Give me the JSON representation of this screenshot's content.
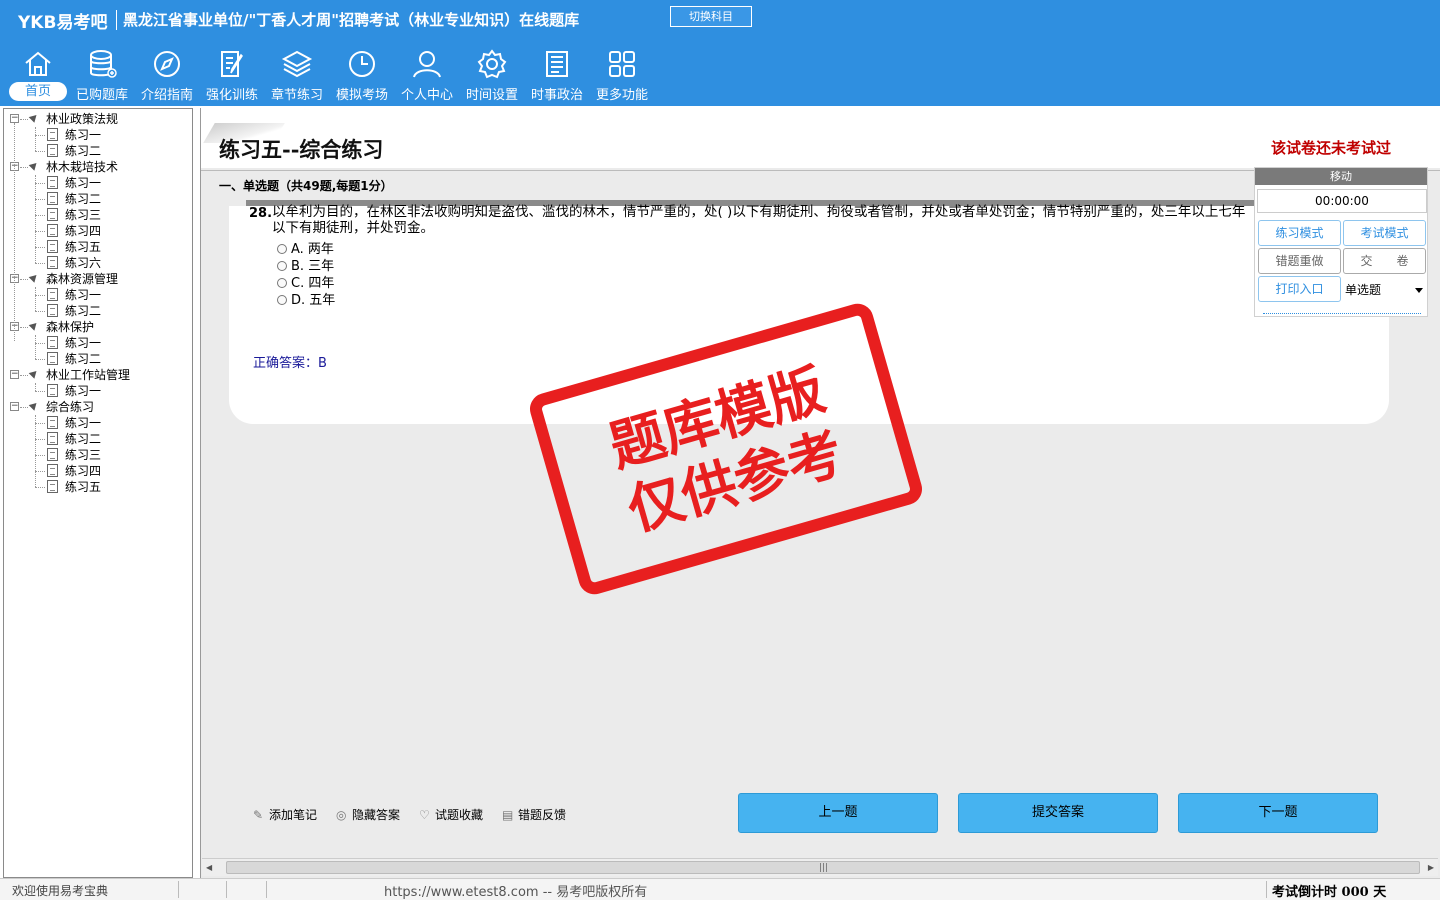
{
  "header": {
    "logo": "YKB易考吧",
    "title": "黑龙江省事业单位/\"丁香人才周\"招聘考试（林业专业知识）在线题库",
    "switch_label": "切换科目",
    "nav": [
      {
        "label": "首页",
        "icon": "home-icon"
      },
      {
        "label": "已购题库",
        "icon": "database-icon"
      },
      {
        "label": "介绍指南",
        "icon": "compass-icon"
      },
      {
        "label": "强化训练",
        "icon": "edit-icon"
      },
      {
        "label": "章节练习",
        "icon": "layers-icon"
      },
      {
        "label": "模拟考场",
        "icon": "clock-icon"
      },
      {
        "label": "个人中心",
        "icon": "user-icon"
      },
      {
        "label": "时间设置",
        "icon": "gear-icon"
      },
      {
        "label": "时事政治",
        "icon": "news-icon"
      },
      {
        "label": "更多功能",
        "icon": "grid-icon"
      }
    ]
  },
  "tree": [
    {
      "label": "林业政策法规",
      "children": [
        "练习一",
        "练习二"
      ]
    },
    {
      "label": "林木栽培技术",
      "children": [
        "练习一",
        "练习二",
        "练习三",
        "练习四",
        "练习五",
        "练习六"
      ]
    },
    {
      "label": "森林资源管理",
      "children": [
        "练习一",
        "练习二"
      ]
    },
    {
      "label": "森林保护",
      "children": [
        "练习一",
        "练习二"
      ]
    },
    {
      "label": "林业工作站管理",
      "children": [
        "练习一"
      ]
    },
    {
      "label": "综合练习",
      "children": [
        "练习一",
        "练习二",
        "练习三",
        "练习四",
        "练习五"
      ]
    }
  ],
  "paper": {
    "title": "练习五--综合练习",
    "status": "该试卷还未考试过",
    "section": "一、单选题（共49题,每题1分）"
  },
  "question": {
    "number": "28.",
    "text": "以牟利为目的，在林区非法收购明知是盗伐、滥伐的林木，情节严重的，处( )以下有期徒刑、拘役或者管制，并处或者单处罚金；情节特别严重的，处三年以上七年以下有期徒刑，并处罚金。",
    "options": [
      "A. 两年",
      "B. 三年",
      "C. 四年",
      "D. 五年"
    ],
    "answer": "正确答案：B"
  },
  "control": {
    "move_label": "移动",
    "timer": "00:00:00",
    "practice_mode": "练习模式",
    "exam_mode": "考试模式",
    "redo_wrong": "错题重做",
    "submit_paper": "交　　卷",
    "print": "打印入口",
    "type_select": "单选题"
  },
  "stamp": {
    "line1": "题库模版",
    "line2": "仅供参考"
  },
  "tools": {
    "add_note": "添加笔记",
    "hide_answer": "隐藏答案",
    "favorite": "试题收藏",
    "feedback": "错题反馈",
    "prev": "上一题",
    "submit": "提交答案",
    "next": "下一题"
  },
  "statusbar": {
    "welcome": "欢迎使用易考宝典",
    "copyright": "https://www.etest8.com -- 易考吧版权所有",
    "countdown": "考试倒计时 000 天"
  },
  "colors": {
    "header_bg": "#2f8fe0",
    "stamp": "#e81f1f",
    "status_red": "#c00000",
    "button_blue": "#46b3f0"
  }
}
